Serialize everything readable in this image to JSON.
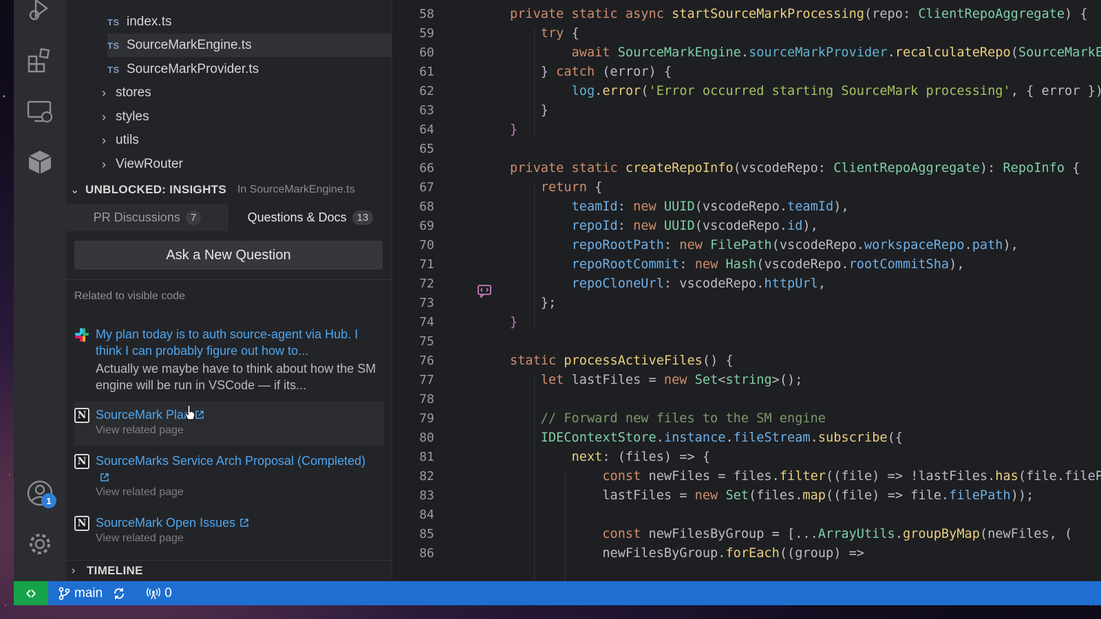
{
  "explorer": {
    "files": [
      {
        "tag": "TS",
        "name": "index.ts"
      },
      {
        "tag": "TS",
        "name": "SourceMarkEngine.ts"
      },
      {
        "tag": "TS",
        "name": "SourceMarkProvider.ts"
      }
    ],
    "folders": [
      "stores",
      "styles",
      "utils",
      "ViewRouter"
    ]
  },
  "insights": {
    "header_title": "UNBLOCKED: INSIGHTS",
    "header_sub": "In SourceMarkEngine.ts",
    "tabs": [
      {
        "label": "PR Discussions",
        "count": "7"
      },
      {
        "label": "Questions & Docs",
        "count": "13"
      }
    ],
    "ask_button": "Ask a New Question",
    "related_label": "Related to visible code",
    "items": [
      {
        "source": "slack",
        "title": "My plan today is to auth source-agent via Hub. I think I can probably figure out how to...",
        "desc": "Actually we maybe have to think about how the SM engine will be run in VSCode — if its..."
      },
      {
        "source": "notion",
        "title": "SourceMark Plan",
        "sub": "View related page"
      },
      {
        "source": "notion",
        "title": "SourceMarks Service Arch Proposal (Completed)",
        "sub": "View related page"
      },
      {
        "source": "notion",
        "title": "SourceMark Open Issues",
        "sub": "View related page"
      }
    ],
    "notion_glyph": "N",
    "timeline": "TIMELINE"
  },
  "editor": {
    "line_numbers": [
      "58",
      "59",
      "60",
      "61",
      "62",
      "63",
      "64",
      "65",
      "66",
      "67",
      "68",
      "69",
      "70",
      "71",
      "72",
      "73",
      "74",
      "75",
      "76",
      "77",
      "78",
      "79",
      "80",
      "81",
      "82",
      "83",
      "84",
      "85",
      "86"
    ]
  },
  "statusbar": {
    "branch": "main",
    "ports": "0",
    "accounts_badge": "1"
  },
  "colors": {
    "accent_blue": "#1f6fd1",
    "remote_green": "#16a34a",
    "link": "#4ea6f0"
  }
}
